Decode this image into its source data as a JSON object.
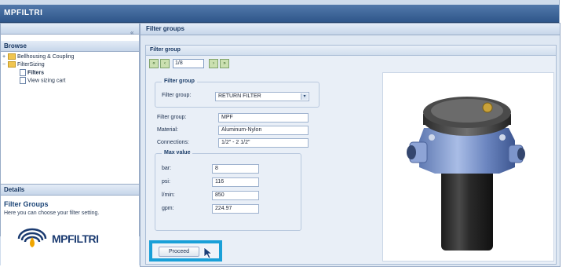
{
  "app": {
    "title": "MPFILTRI"
  },
  "left_panel": {
    "collapse_glyph": "«",
    "browse_header": "Browse",
    "tree": [
      {
        "label": "Bellhousing & Coupling",
        "level": 0,
        "expander": "+",
        "type": "folder"
      },
      {
        "label": "FilterSizing",
        "level": 0,
        "expander": "−",
        "type": "folder"
      },
      {
        "label": "Filters",
        "level": 1,
        "expander": "",
        "type": "doc"
      },
      {
        "label": "View sizing cart",
        "level": 1,
        "expander": "",
        "type": "doc"
      }
    ],
    "details": {
      "header": "Details",
      "title": "Filter Groups",
      "text": "Here you can choose your filter setting."
    },
    "logo_text": "MPFILTRI"
  },
  "main": {
    "header": "Filter groups",
    "panel_title": "Filter group",
    "pager": {
      "first": "«",
      "prev": "‹",
      "page": "1/8",
      "next": "›",
      "last": "»"
    },
    "filter_group_section": {
      "legend": "Filter group",
      "label": "Filter group:",
      "selected": "RETURN FILTER",
      "arrow": "▾"
    },
    "details_fields": [
      {
        "label": "Filter group:",
        "value": "MPF"
      },
      {
        "label": "Material:",
        "value": "Aluminum-Nylon"
      },
      {
        "label": "Connections:",
        "value": "1/2\" - 2 1/2\""
      }
    ],
    "max_value": {
      "legend": "Max value",
      "rows": [
        {
          "label": "bar:",
          "value": "8"
        },
        {
          "label": "psi:",
          "value": "116"
        },
        {
          "label": "l/min:",
          "value": "850"
        },
        {
          "label": "gpm:",
          "value": "224.97"
        }
      ]
    },
    "proceed_label": "Proceed"
  }
}
